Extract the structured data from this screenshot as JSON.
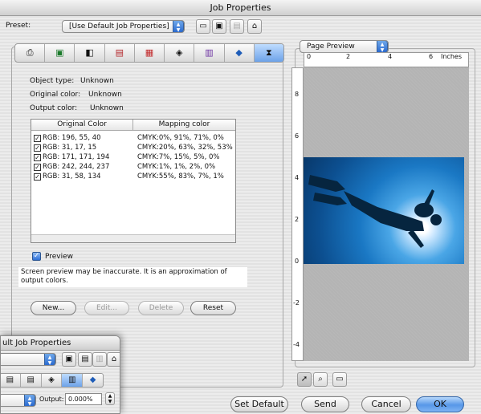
{
  "window": {
    "title": "Job Properties"
  },
  "preset": {
    "label": "Preset:",
    "selected": "[Use Default Job Properties]",
    "buttons": [
      "open-icon",
      "save-icon",
      "save-as-icon",
      "trash-icon"
    ]
  },
  "tabs": [
    "printer-icon",
    "page-setup-icon",
    "color-icon",
    "color-bars-icon",
    "halftone-icon",
    "color-mapping-icon",
    "swatch-icon",
    "layers-icon",
    "output-icon"
  ],
  "active_tab": 8,
  "info": {
    "object_type_label": "Object type:",
    "object_type_value": "Unknown",
    "original_color_label": "Original color:",
    "original_color_value": "Unknown",
    "output_color_label": "Output color:",
    "output_color_value": "Unknown"
  },
  "mapping_table": {
    "headers": [
      "Original Color",
      "Mapping color"
    ],
    "rows": [
      {
        "original": "RGB: 196, 55, 40",
        "mapping": "CMYK:0%, 91%, 71%, 0%"
      },
      {
        "original": "RGB: 31, 17, 15",
        "mapping": "CMYK:20%, 63%, 32%, 53%"
      },
      {
        "original": "RGB: 171, 171, 194",
        "mapping": "CMYK:7%, 15%, 5%, 0%"
      },
      {
        "original": "RGB: 242, 244, 237",
        "mapping": "CMYK:1%, 1%, 2%, 0%"
      },
      {
        "original": "RGB: 31, 58, 134",
        "mapping": "CMYK:55%, 83%, 7%, 1%"
      }
    ]
  },
  "preview": {
    "checkbox_label": "Preview",
    "checked": true,
    "warning": "Screen preview may be inaccurate. It is an approximation of output colors."
  },
  "table_buttons": {
    "new": "New...",
    "edit": "Edit...",
    "delete": "Delete",
    "reset": "Reset"
  },
  "right_panel": {
    "view_selected": "Page Preview",
    "ruler_top": [
      "0",
      "2",
      "4",
      "6",
      "Inches"
    ],
    "ruler_left": [
      "8",
      "6",
      "4",
      "2",
      "0",
      "-2",
      "-4"
    ],
    "tools": [
      "arrow-icon",
      "zoom-icon",
      "page-icon"
    ]
  },
  "footer": {
    "set_default": "Set Default",
    "send": "Send",
    "cancel": "Cancel",
    "ok": "OK"
  },
  "background_window": {
    "title": "ult Job Properties",
    "output_label": "Output:",
    "output_value": "0.000%"
  }
}
